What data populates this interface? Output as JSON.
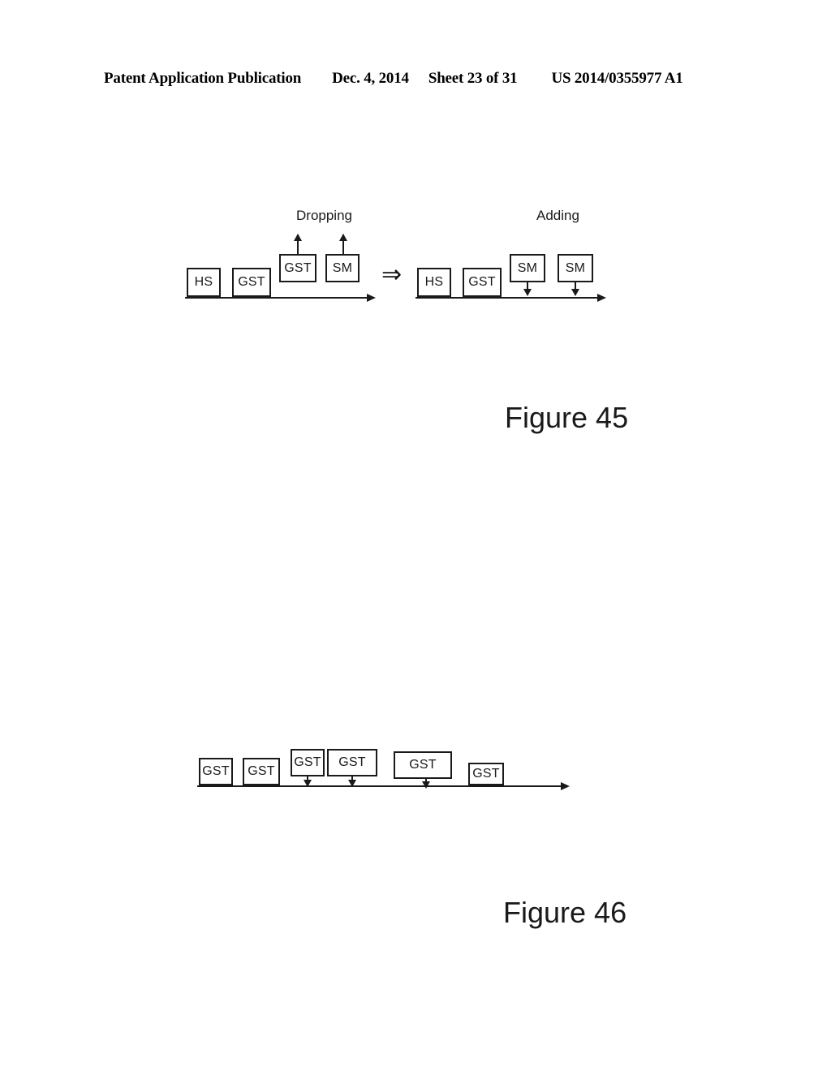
{
  "header": {
    "publication": "Patent Application Publication",
    "date": "Dec. 4, 2014",
    "sheet": "Sheet 23 of 31",
    "number": "US 2014/0355977 A1"
  },
  "figure45": {
    "title": "Figure 45",
    "left_label": "Dropping",
    "right_label": "Adding",
    "transition_arrow": "⇒",
    "left_diagram": {
      "boxes": [
        {
          "label": "HS",
          "position": "baseline",
          "arrow": "none"
        },
        {
          "label": "GST",
          "position": "baseline",
          "arrow": "none"
        },
        {
          "label": "GST",
          "position": "raised",
          "arrow": "up"
        },
        {
          "label": "SM",
          "position": "raised",
          "arrow": "up"
        }
      ]
    },
    "right_diagram": {
      "boxes": [
        {
          "label": "HS",
          "position": "baseline",
          "arrow": "none"
        },
        {
          "label": "GST",
          "position": "baseline",
          "arrow": "none"
        },
        {
          "label": "SM",
          "position": "raised",
          "arrow": "down"
        },
        {
          "label": "SM",
          "position": "raised",
          "arrow": "down"
        }
      ]
    }
  },
  "figure46": {
    "title": "Figure 46",
    "diagram": {
      "boxes": [
        {
          "label": "GST",
          "position": "baseline",
          "arrow": "none"
        },
        {
          "label": "GST",
          "position": "baseline",
          "arrow": "none"
        },
        {
          "label": "GST",
          "position": "raised",
          "arrow": "down"
        },
        {
          "label": "GST",
          "position": "raised",
          "arrow": "down"
        },
        {
          "label": "GST",
          "position": "raised",
          "arrow": "down"
        },
        {
          "label": "GST",
          "position": "baseline",
          "arrow": "none"
        }
      ]
    }
  },
  "colors": {
    "ink": "#1a1a1a",
    "page": "#ffffff"
  }
}
